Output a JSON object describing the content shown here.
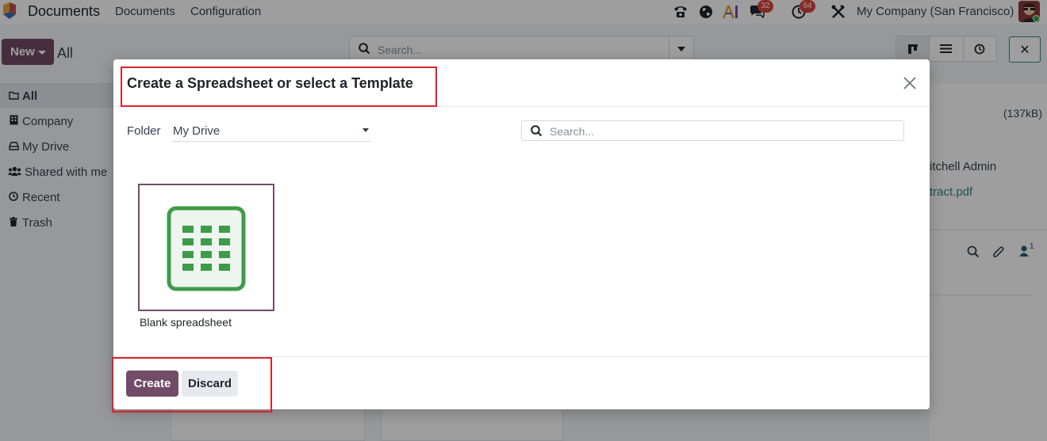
{
  "navbar": {
    "app_title": "Documents",
    "menus": [
      "Documents",
      "Configuration"
    ],
    "badges": {
      "messages": "32",
      "activities": "64"
    },
    "company": "My Company (San Francisco)",
    "icons": [
      "phone-icon",
      "globe-icon",
      "ai-icon",
      "chat-icon",
      "clock-icon",
      "tools-icon"
    ]
  },
  "control_panel": {
    "new_label": "New",
    "breadcrumb": "All",
    "search_placeholder": "Search..."
  },
  "sidebar": {
    "items": [
      {
        "label": "All",
        "icon": "folder-icon"
      },
      {
        "label": "Company",
        "icon": "building-icon"
      },
      {
        "label": "My Drive",
        "icon": "drive-icon"
      },
      {
        "label": "Shared with me",
        "icon": "users-icon"
      },
      {
        "label": "Recent",
        "icon": "clock-icon"
      },
      {
        "label": "Trash",
        "icon": "trash-icon"
      }
    ]
  },
  "details": {
    "size": "(137kB)",
    "owner": "itchell Admin",
    "file": "tract.pdf",
    "follower_count": "1"
  },
  "modal": {
    "title": "Create a Spreadsheet or select a Template",
    "folder_label": "Folder",
    "folder_value": "My Drive",
    "search_placeholder": "Search...",
    "templates": [
      {
        "label": "Blank spreadsheet"
      }
    ],
    "create_label": "Create",
    "discard_label": "Discard",
    "accent_color": "#714b67",
    "highlight_color": "#d9232e"
  }
}
